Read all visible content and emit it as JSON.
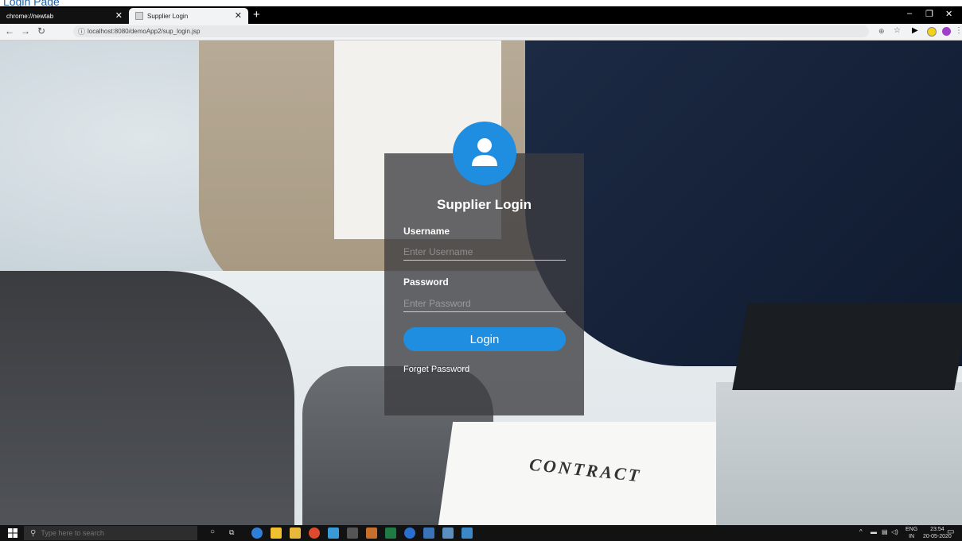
{
  "browser": {
    "tabs": [
      {
        "label": "chrome://newtab"
      },
      {
        "label": "Supplier Login"
      }
    ],
    "url": "localhost:8080/demoApp2/sup_login.jsp"
  },
  "login": {
    "title": "Supplier Login",
    "username_label": "Username",
    "username_placeholder": "Enter Username",
    "password_label": "Password",
    "password_placeholder": "Enter Password",
    "login_button": "Login",
    "forget_link": "Forget Password"
  },
  "background": {
    "document_heading": "CONTRACT"
  },
  "taskbar": {
    "search_placeholder": "Type here to search",
    "language": "ENG",
    "region": "IN",
    "time": "23:54",
    "date": "20-05-2020"
  },
  "colors": {
    "accent": "#1f8ee0",
    "card": "#3c3c40"
  },
  "icons": [
    "close-icon",
    "plus-icon",
    "back-arrow-icon",
    "forward-arrow-icon",
    "reload-icon",
    "info-icon",
    "zoom-icon",
    "star-icon",
    "user-icon",
    "windows-start-icon",
    "search-icon"
  ]
}
